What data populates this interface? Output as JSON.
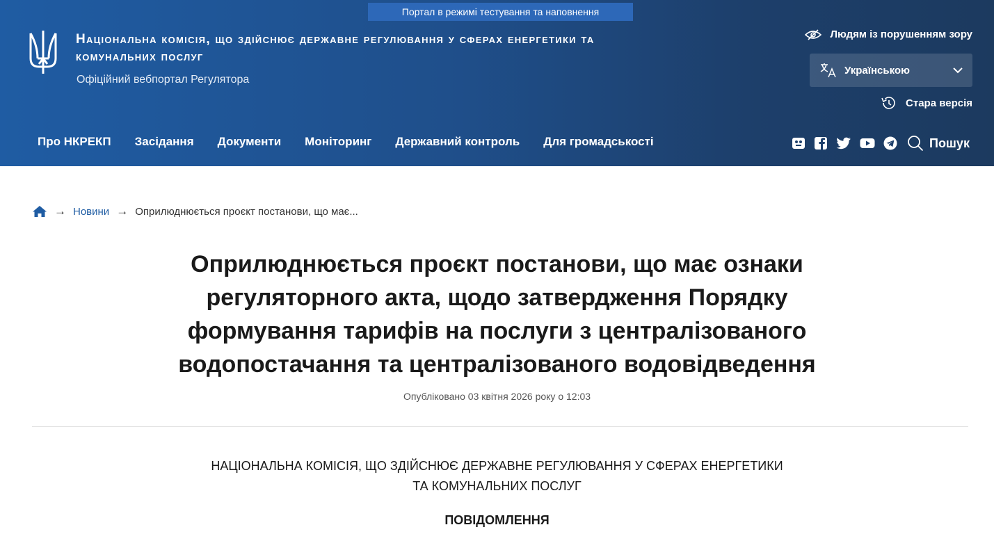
{
  "header": {
    "test_banner": "Портал в режимі тестування та наповнення",
    "org_title": "Національна комісія, що здійснює державне регулювання у сферах енергетики та комунальних послуг",
    "org_subtitle": "Офіційний вебпортал Регулятора",
    "vision_link": "Людям із порушенням зору",
    "language": {
      "selected": "Українською"
    },
    "old_version": "Стара версія",
    "search_label": "Пошук"
  },
  "nav": {
    "items": [
      {
        "label": "Про НКРЕКП"
      },
      {
        "label": "Засідання"
      },
      {
        "label": "Документи"
      },
      {
        "label": "Моніторинг"
      },
      {
        "label": "Державний контроль"
      },
      {
        "label": "Для громадськості"
      }
    ]
  },
  "social": [
    "gitlab-icon",
    "facebook-icon",
    "twitter-icon",
    "youtube-icon",
    "telegram-icon"
  ],
  "breadcrumb": {
    "home_icon": "home-icon",
    "items": [
      "Новини",
      "Оприлюднюється проєкт постанови, що має..."
    ]
  },
  "article": {
    "title": "Оприлюднюється проєкт постанови, що має ознаки регуляторного акта, щодо затвердження Порядку формування тарифів на послуги з централізованого водопостачання та централізованого водовідведення",
    "published": "Опубліковано 03 квітня 2026 року о 12:03",
    "body_heading": "НАЦІОНАЛЬНА КОМІСІЯ, ЩО ЗДІЙСНЮЄ ДЕРЖАВНЕ РЕГУЛЮВАННЯ У СФЕРАХ ЕНЕРГЕТИКИ ТА КОМУНАЛЬНИХ ПОСЛУГ",
    "notice": "ПОВІДОМЛЕННЯ"
  },
  "colors": {
    "header_start": "#1f5ca3",
    "header_end": "#1c3a5f",
    "banner": "#2d68b8",
    "link": "#1f5ca3"
  }
}
